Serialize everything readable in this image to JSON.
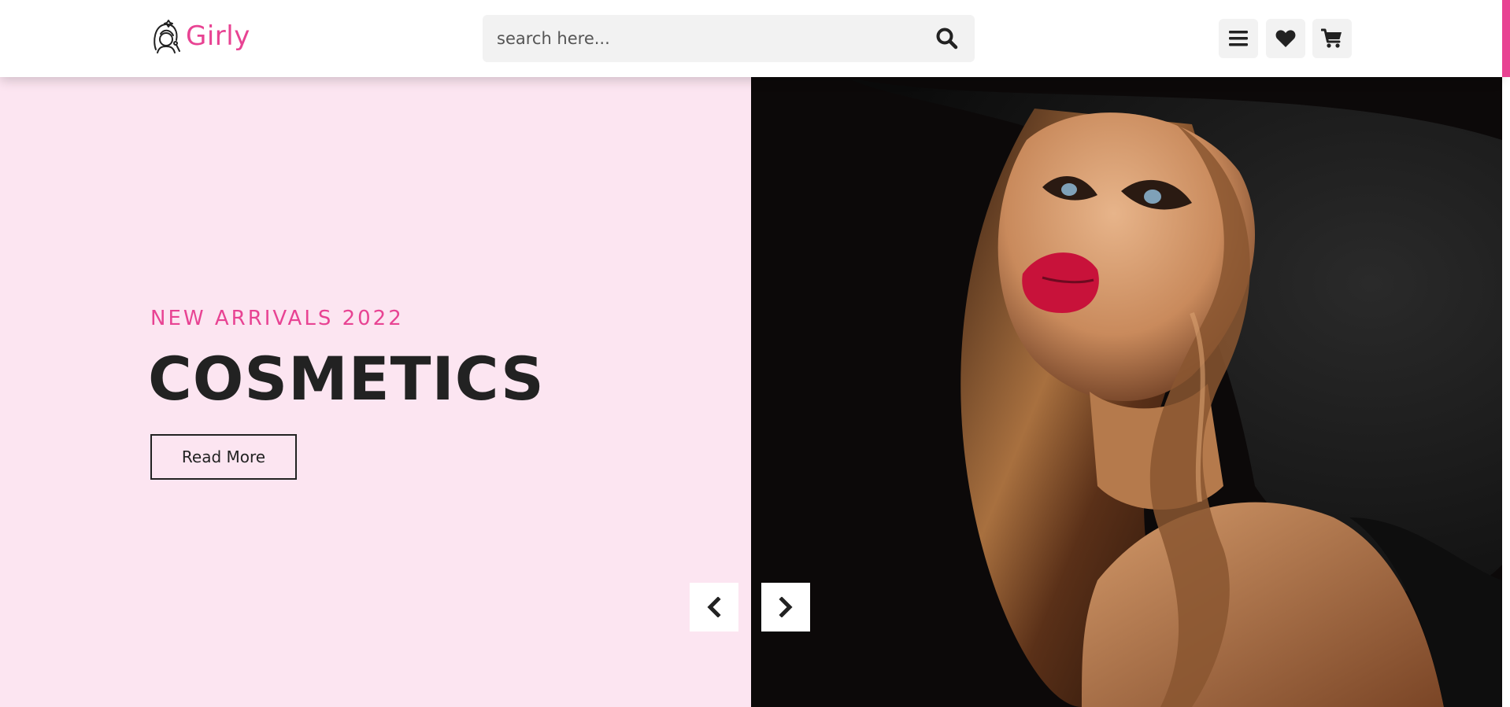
{
  "header": {
    "logo": {
      "text": "Girly",
      "icon": "girl-face-icon"
    },
    "search": {
      "placeholder": "search here...",
      "icon": "search-icon"
    },
    "actions": [
      {
        "name": "menu",
        "icon": "bars-icon"
      },
      {
        "name": "wishlist",
        "icon": "heart-icon"
      },
      {
        "name": "cart",
        "icon": "shopping-cart-icon"
      }
    ]
  },
  "hero": {
    "subtitle": "NEW ARRIVALS 2022",
    "title": "COSMETICS",
    "cta_label": "Read More",
    "image_alt": "woman with red lipstick and black hat",
    "prev_icon": "chevron-left-icon",
    "next_icon": "chevron-right-icon"
  },
  "colors": {
    "accent": "#e84393",
    "hero_bg": "#fce5f1",
    "dark_text": "#222222",
    "search_bg": "#f2f2f2"
  }
}
